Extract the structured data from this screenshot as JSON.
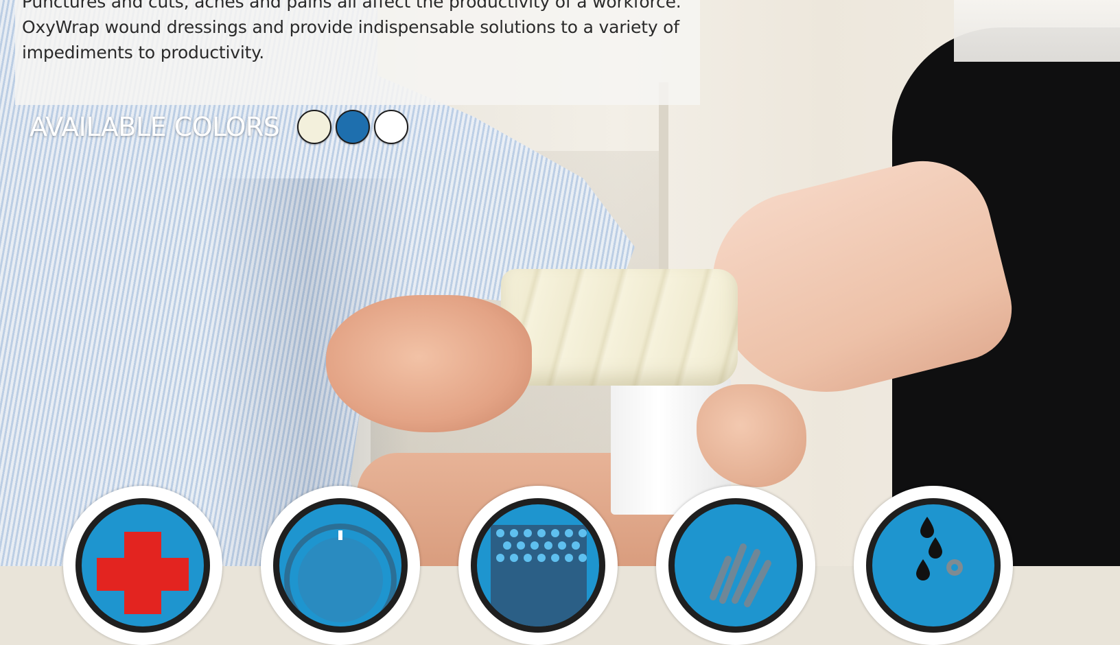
{
  "intro": {
    "line1": "Punctures and cuts, aches and pains all affect the productivity of a workforce.",
    "line2": "OxyWrap wound dressings and provide indispensable solutions to a variety of",
    "line3": "impediments to productivity."
  },
  "colors": {
    "label": "AVAILABLE COLORS",
    "swatches": [
      {
        "name": "cream",
        "hex": "#f3f0dc"
      },
      {
        "name": "blue",
        "hex": "#1e6fae"
      },
      {
        "name": "white",
        "hex": "#ffffff"
      }
    ]
  },
  "badges": [
    {
      "icon": "first-aid-cross-icon"
    },
    {
      "icon": "gauge-dial-icon"
    },
    {
      "icon": "perforated-dots-icon"
    },
    {
      "icon": "glove-hand-icon"
    },
    {
      "icon": "water-drops-gear-icon"
    }
  ],
  "theme": {
    "badge_blue": "#1e95cf",
    "badge_ring": "#1f1f1f",
    "accent_red": "#e32420"
  }
}
